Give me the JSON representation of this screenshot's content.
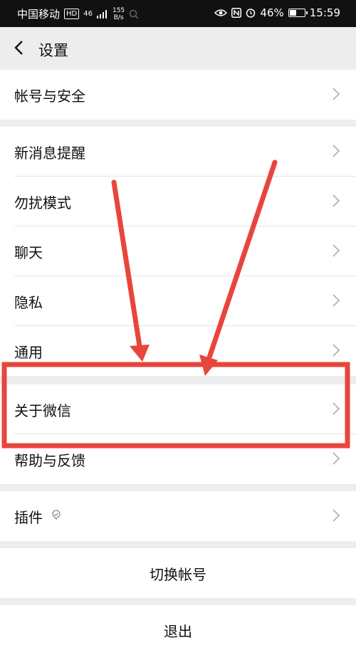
{
  "status_bar": {
    "carrier": "中国移动",
    "hd": "HD",
    "network": "46",
    "net_speed_value": "155",
    "net_speed_unit": "B/s",
    "battery": "46%",
    "time": "15:59"
  },
  "nav": {
    "title": "设置"
  },
  "sections": {
    "account": {
      "label": "帐号与安全"
    },
    "settings": [
      {
        "label": "新消息提醒"
      },
      {
        "label": "勿扰模式"
      },
      {
        "label": "聊天"
      },
      {
        "label": "隐私"
      },
      {
        "label": "通用"
      }
    ],
    "about": [
      {
        "label": "关于微信"
      },
      {
        "label": "帮助与反馈"
      }
    ],
    "plugins": {
      "label": "插件"
    }
  },
  "actions": {
    "switch_account": "切换帐号",
    "logout": "退出"
  },
  "annotation": {
    "color": "#e8453c"
  },
  "battery_level": 0.46
}
